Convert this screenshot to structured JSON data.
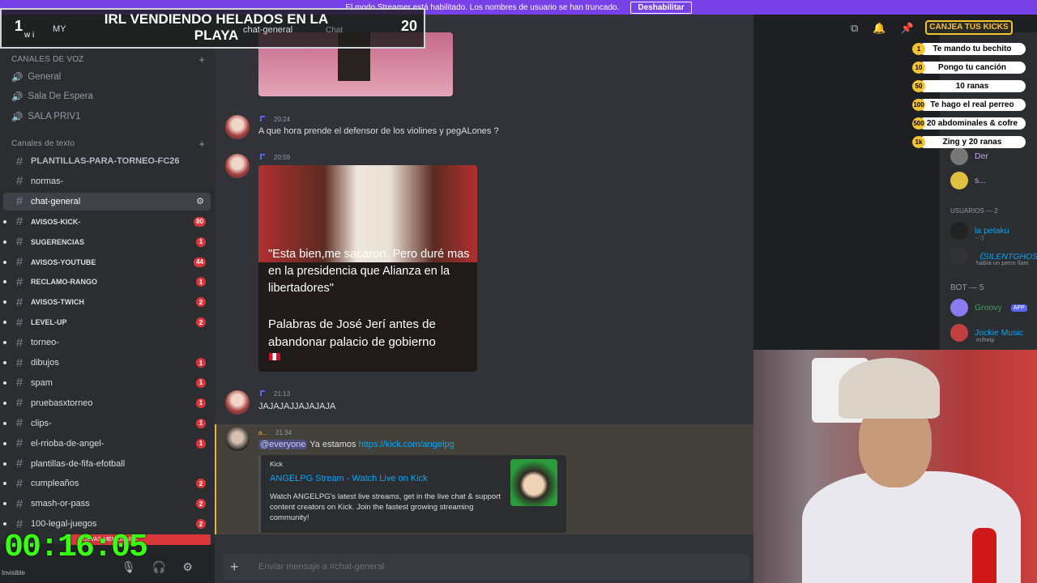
{
  "streamer_bar": {
    "message": "El modo Streamer está habilitado. Los nombres de usuario se han truncado.",
    "button": "Deshabilitar"
  },
  "overlay": {
    "rank_left": "1",
    "rank_right": "20",
    "title": "IRL VENDIENDO HELADOS EN LA PLAYA",
    "small_text": "w i",
    "server_name": "MY",
    "channel": "chat-general",
    "tab": "Chat"
  },
  "sidebar": {
    "voice_section": "CANALES DE VOZ",
    "voice_channels": [
      "General",
      "Sala De Espera",
      "SALA PRIV1"
    ],
    "text_section": "Canales de texto",
    "channels": [
      {
        "name": "PLANTILLAS-PARA-TORNEO-FC26",
        "badge": ""
      },
      {
        "name": "normas-",
        "badge": ""
      },
      {
        "name": "chat-general",
        "badge": ""
      },
      {
        "name": "avisos-kick-",
        "badge": "80"
      },
      {
        "name": "sugerencias",
        "badge": "1"
      },
      {
        "name": "avisos-youtube",
        "badge": "44"
      },
      {
        "name": "reclamo-rango",
        "badge": "1"
      },
      {
        "name": "avisos-twich",
        "badge": "2"
      },
      {
        "name": "level-up",
        "badge": "2"
      },
      {
        "name": "torneo-",
        "badge": ""
      },
      {
        "name": "dibujos",
        "badge": "1"
      },
      {
        "name": "spam",
        "badge": "1"
      },
      {
        "name": "pruebasxtorneo",
        "badge": "1"
      },
      {
        "name": "clips-",
        "badge": "1"
      },
      {
        "name": "el-rrioba-de-angel-",
        "badge": "1"
      },
      {
        "name": "plantillas-de-fifa-efotball",
        "badge": ""
      },
      {
        "name": "cumpleaños",
        "badge": "2"
      },
      {
        "name": "smash-or-pass",
        "badge": "2"
      },
      {
        "name": "100-legal-juegos",
        "badge": "2"
      }
    ],
    "mentions_bar": "NUEVAS MENCIONES",
    "status": "Invisible"
  },
  "timer": "00:16:05",
  "messages": [
    {
      "time": "20:24",
      "text": "A que hora prende el defensor de los violines y pegALones ?"
    },
    {
      "time": "20:59",
      "quote": "\"Esta bien,me sacaron. Pero duré mas en la presidencia que Alianza en la libertadores\"",
      "caption": "Palabras de José Jerí antes de abandonar palacio de gobierno"
    },
    {
      "time": "21:13",
      "text": "JAJAJAJJAJAJAJA"
    },
    {
      "time": "21:34",
      "author": "a...",
      "mention": "@everyone",
      "text": "Ya estamos",
      "link": "https://kick.com/angelpg"
    }
  ],
  "embed": {
    "provider": "Kick",
    "title": "ANGELPG Stream - Watch Live on Kick",
    "description": "Watch ANGELPG's latest live streams, get in the live chat & support content creators on Kick. Join the fastest growing streaming community!"
  },
  "input_placeholder": "Enviar mensaje a #chat-general",
  "kicks": {
    "header": "CANJEA TUS KICKS",
    "rewards": [
      {
        "cost": "1",
        "label": "Te mando tu bechito"
      },
      {
        "cost": "10",
        "label": "Pongo tu canción"
      },
      {
        "cost": "50",
        "label": "10 ranas"
      },
      {
        "cost": "100",
        "label": "Te hago el real perreo"
      },
      {
        "cost": "500",
        "label": "20 abdominales & cofre"
      },
      {
        "cost": "1k",
        "label": "Zing y 20 ranas"
      }
    ]
  },
  "members": {
    "misc": [
      "Der",
      "s..."
    ],
    "usuarios_section": "USUARIOS — 2",
    "usuarios": [
      {
        "name": "la petaku",
        "sub": "- :)"
      },
      {
        "name": "《SILENTGHOS",
        "sub": "había un perro llam"
      }
    ],
    "bot_section": "BOT — 5",
    "bots": [
      {
        "name": "Groovy",
        "tag": "APP"
      },
      {
        "name": "Jockie Music",
        "sub": "m!help"
      }
    ]
  }
}
